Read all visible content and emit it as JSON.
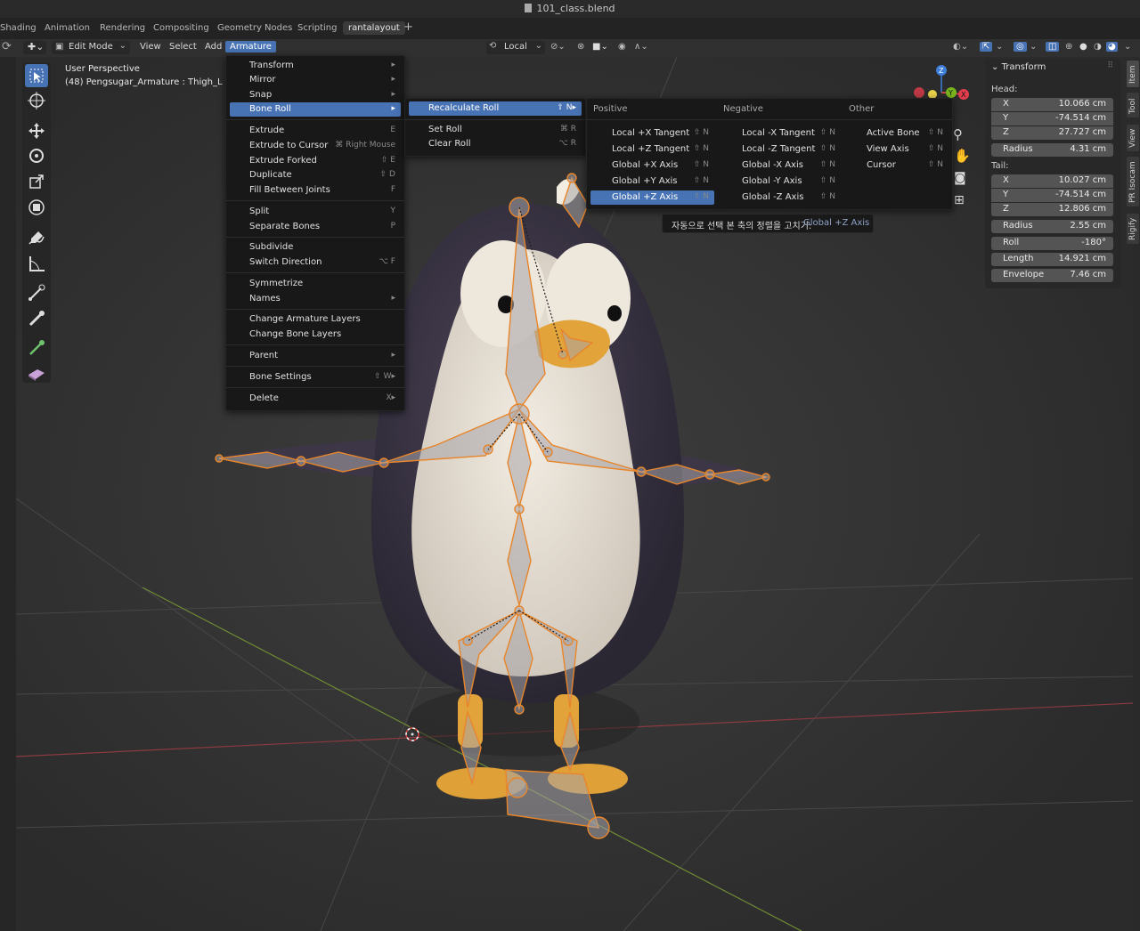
{
  "window": {
    "title": "101_class.blend"
  },
  "workspace_tabs": [
    "Shading",
    "Animation",
    "Rendering",
    "Compositing",
    "Geometry Nodes",
    "Scripting",
    "rantalayout"
  ],
  "active_tab": "rantalayout",
  "header": {
    "mode": "Edit Mode",
    "menus": [
      "View",
      "Select",
      "Add",
      "Armature"
    ],
    "transform_orientation": "Local"
  },
  "viewport": {
    "perspective": "User Perspective",
    "object_info": "(48) Pengsugar_Armature : Thigh_L"
  },
  "armature_menu": {
    "items": [
      {
        "label": "Transform",
        "shortcut": "▸"
      },
      {
        "label": "Mirror",
        "shortcut": "▸"
      },
      {
        "label": "Snap",
        "shortcut": "▸"
      },
      {
        "label": "Bone Roll",
        "shortcut": "▸"
      },
      {
        "label": "Extrude",
        "shortcut": "E"
      },
      {
        "label": "Extrude to Cursor",
        "shortcut": "⌘ Right Mouse"
      },
      {
        "label": "Extrude Forked",
        "shortcut": "⇧ E"
      },
      {
        "label": "Duplicate",
        "shortcut": "⇧ D"
      },
      {
        "label": "Fill Between Joints",
        "shortcut": "F"
      },
      {
        "label": "Split",
        "shortcut": "Y"
      },
      {
        "label": "Separate Bones",
        "shortcut": "P"
      },
      {
        "label": "Subdivide",
        "shortcut": ""
      },
      {
        "label": "Switch Direction",
        "shortcut": "⌥ F"
      },
      {
        "label": "Symmetrize",
        "shortcut": ""
      },
      {
        "label": "Names",
        "shortcut": "▸"
      },
      {
        "label": "Change Armature Layers",
        "shortcut": ""
      },
      {
        "label": "Change Bone Layers",
        "shortcut": ""
      },
      {
        "label": "Parent",
        "shortcut": "▸"
      },
      {
        "label": "Bone Settings",
        "shortcut": "⇧ W▸"
      },
      {
        "label": "Delete",
        "shortcut": "X▸"
      }
    ]
  },
  "bone_roll_menu": {
    "items": [
      {
        "label": "Recalculate Roll",
        "shortcut": "⇧ N▸"
      },
      {
        "label": "Set Roll",
        "shortcut": "⌘ R"
      },
      {
        "label": "Clear Roll",
        "shortcut": "⌥ R"
      }
    ]
  },
  "recalc_menu": {
    "headers": [
      "Positive",
      "Negative",
      "Other"
    ],
    "positive": [
      "Local +X Tangent",
      "Local +Z Tangent",
      "Global +X Axis",
      "Global +Y Axis",
      "Global +Z Axis"
    ],
    "negative": [
      "Local -X Tangent",
      "Local -Z Tangent",
      "Global -X Axis",
      "Global -Y Axis",
      "Global -Z Axis"
    ],
    "other": [
      "Active Bone",
      "View Axis",
      "Cursor"
    ],
    "shortcut": "⇧ N"
  },
  "tooltip": {
    "text": "자동으로 선택 본 축의 정렬을 고치기:",
    "value": "Global +Z Axis"
  },
  "n_panel": {
    "title": "Transform",
    "head_label": "Head:",
    "head": [
      {
        "k": "X",
        "v": "10.066 cm"
      },
      {
        "k": "Y",
        "v": "-74.514 cm"
      },
      {
        "k": "Z",
        "v": "27.727 cm"
      }
    ],
    "head_radius": {
      "k": "Radius",
      "v": "4.31 cm"
    },
    "tail_label": "Tail:",
    "tail": [
      {
        "k": "X",
        "v": "10.027 cm"
      },
      {
        "k": "Y",
        "v": "-74.514 cm"
      },
      {
        "k": "Z",
        "v": "12.806 cm"
      }
    ],
    "tail_radius": {
      "k": "Radius",
      "v": "2.55 cm"
    },
    "roll": {
      "k": "Roll",
      "v": "-180°"
    },
    "length": {
      "k": "Length",
      "v": "14.921 cm"
    },
    "envelope": {
      "k": "Envelope",
      "v": "7.46 cm"
    }
  },
  "sidebar_tabs": [
    "Item",
    "Tool",
    "View",
    "PR Isocam",
    "Rigify"
  ],
  "gizmo": {
    "z_label": "Z",
    "y_label": "Y",
    "x_label": "X"
  },
  "colors": {
    "accent": "#4772b3",
    "bone_orange": "#e8852a",
    "x_axis": "#e23d4c",
    "y_axis": "#78b41e",
    "z_axis": "#3c7ed8"
  }
}
